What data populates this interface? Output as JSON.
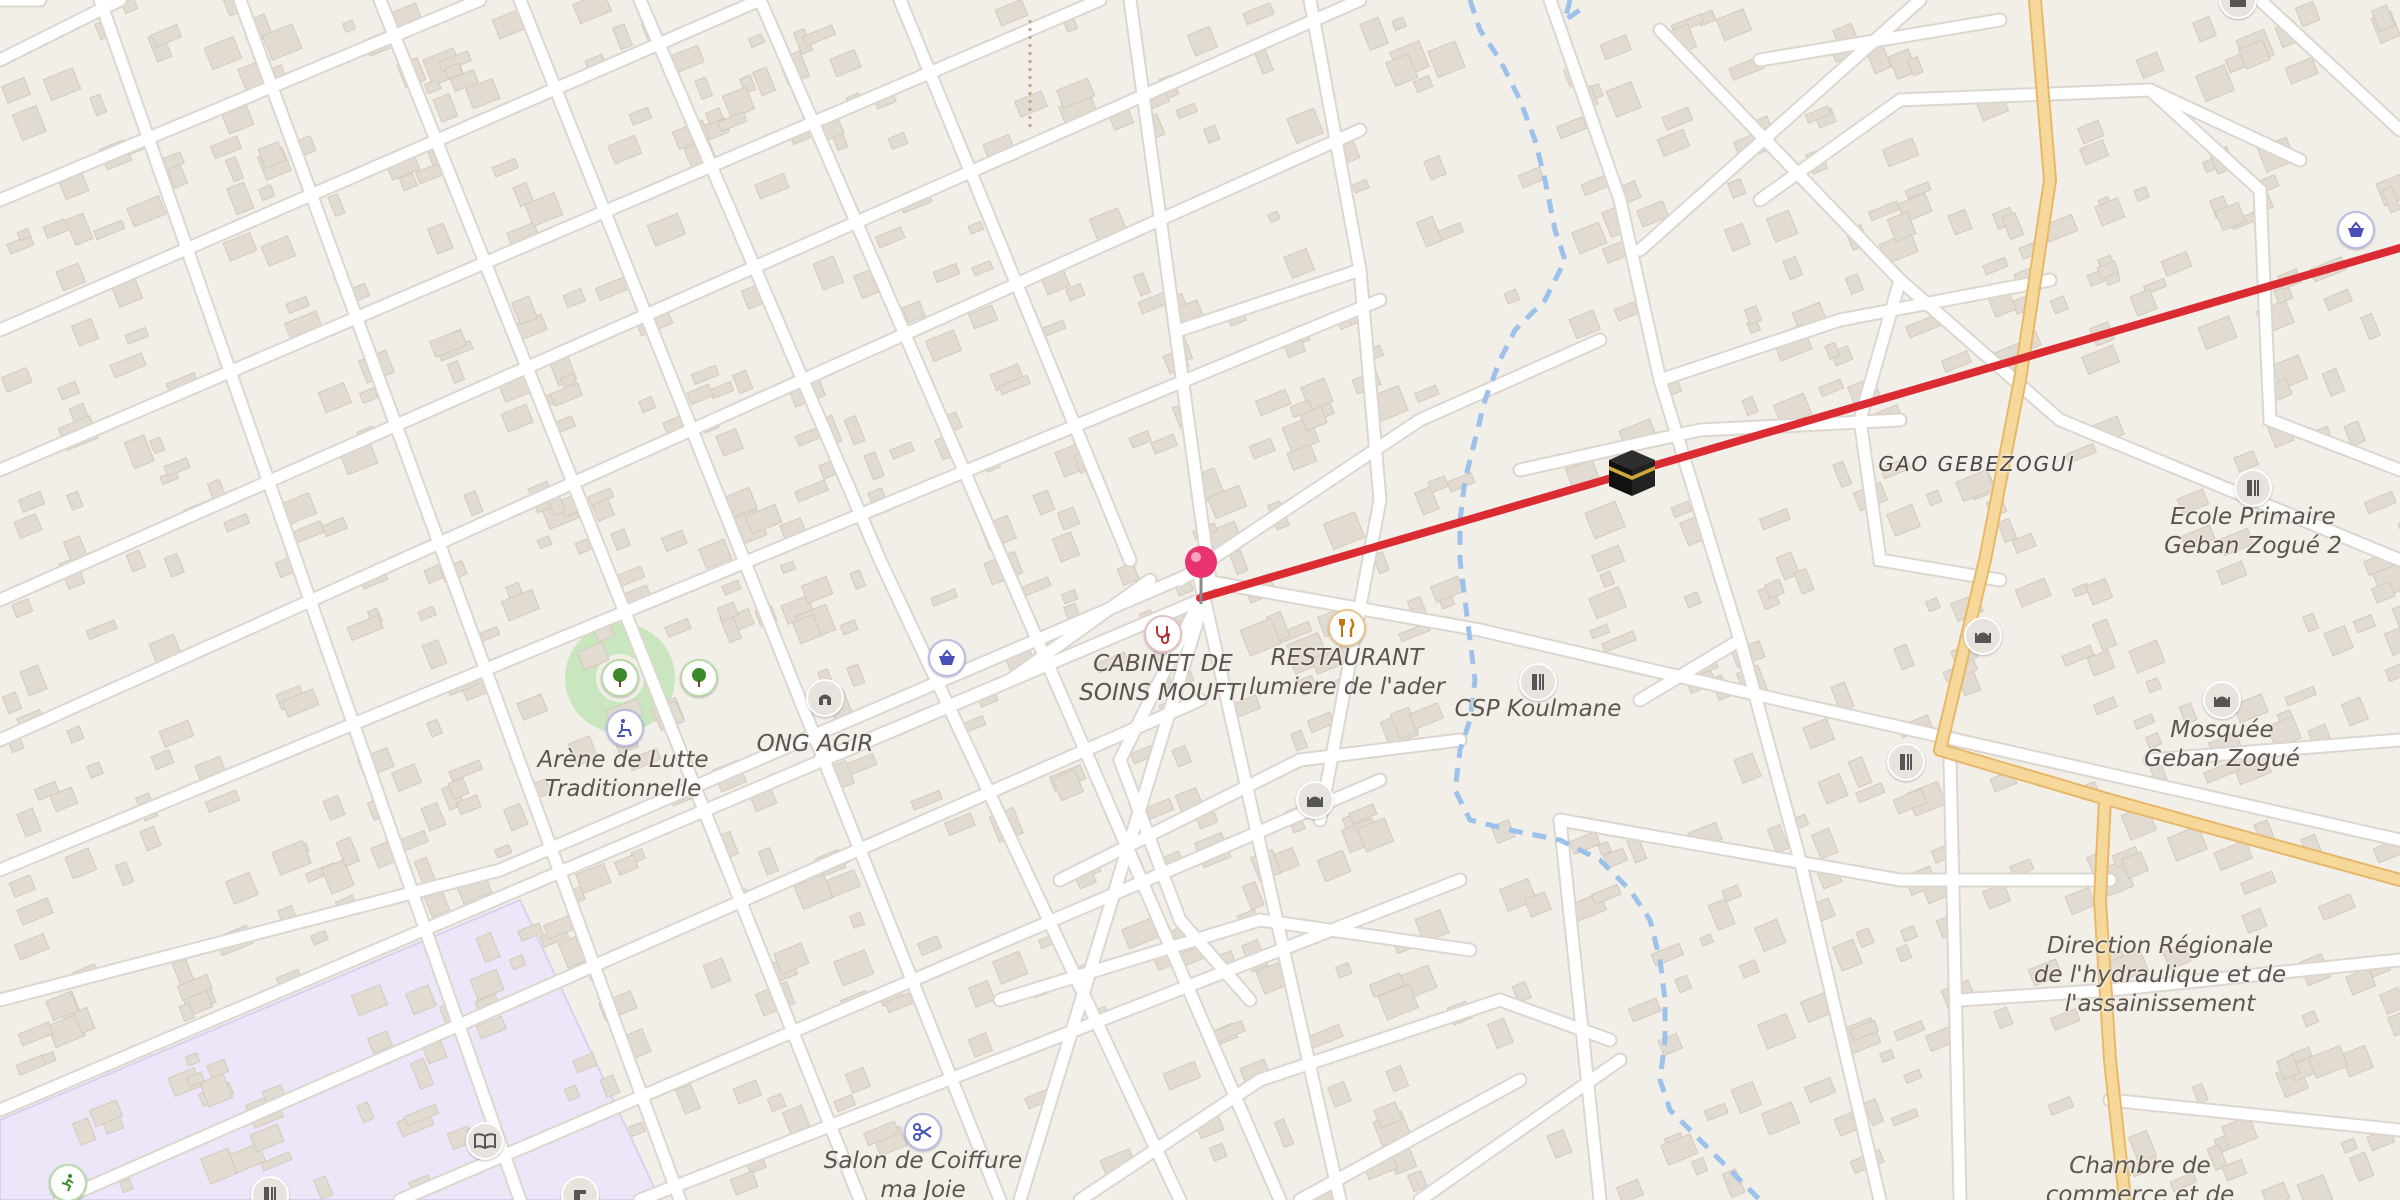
{
  "map": {
    "colors": {
      "background": "#f2efe9",
      "building": "#e2dbd1",
      "road": "#ffffff",
      "road_outline": "#dcd6cf",
      "primary_road": "#f6d99a",
      "primary_road_outline": "#e8b86a",
      "stream": "#9cc1ea",
      "industrial_zone": "#ece6f8",
      "park": "#c9e6bf",
      "route_line": "#dc2c33",
      "marker": "#e8336f"
    },
    "labels": {
      "arene": "Arène de Lutte\nTraditionnelle",
      "ong": "ONG AGIR",
      "cabinet": "CABINET DE\nSOINS MOUFTI",
      "restaurant": "RESTAURANT\nlumiere de l'ader",
      "csp": "CSP Koulmane",
      "gao": "GAO GEBEZOGUI",
      "ecole": "Ecole Primaire\nGeban Zogué 2",
      "mosquee": "Mosquée\nGeban Zogué",
      "direction": "Direction Régionale\nde l'hydraulique et de\nl'assainissement",
      "salon": "Salon de Coiffure\nma Joie",
      "chambre": "Chambre de\ncommerce et de"
    },
    "icons": {
      "marker": "map-pin-icon",
      "kaaba": "kaaba-icon",
      "shop_top": "shopping-basket-icon",
      "shop_mid": "shopping-basket-icon",
      "doctor": "stethoscope-icon",
      "restaurant": "fork-knife-icon",
      "csp": "school-icon",
      "ecole": "school-icon",
      "school_mid": "school-icon",
      "mosque_top": "mosque-icon",
      "mosque_right": "mosque-icon",
      "mosque_center": "mosque-icon",
      "ong": "community-centre-icon",
      "tree1": "tree-icon",
      "tree2": "tree-icon",
      "arene": "sports-centre-icon",
      "library": "library-icon",
      "salon": "scissors-icon",
      "running": "running-icon"
    }
  }
}
